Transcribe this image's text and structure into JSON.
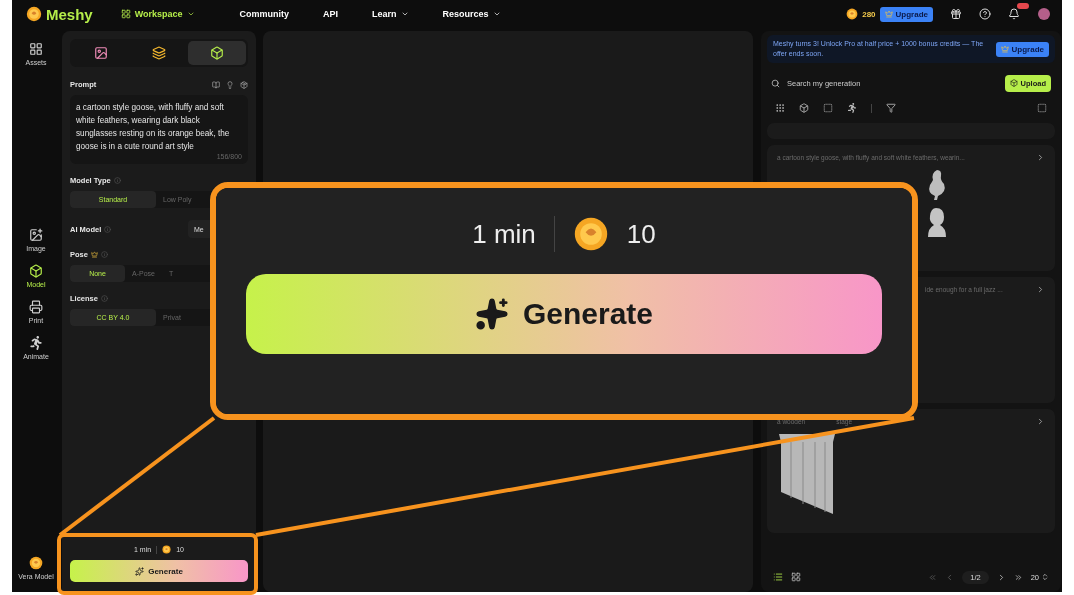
{
  "topbar": {
    "logo": "Meshy",
    "nav": [
      {
        "label": "Workspace",
        "kind": "workspace",
        "dropdown": true
      },
      {
        "label": "Community",
        "kind": "link",
        "dropdown": false
      },
      {
        "label": "API",
        "kind": "link",
        "dropdown": false
      },
      {
        "label": "Learn",
        "kind": "link",
        "dropdown": true
      },
      {
        "label": "Resources",
        "kind": "link",
        "dropdown": true
      }
    ],
    "credits": "280",
    "upgrade": "Upgrade"
  },
  "rail": [
    {
      "label": "Assets",
      "kind": "assets",
      "selected": false
    },
    {
      "label": "Image",
      "kind": "image",
      "selected": false
    },
    {
      "label": "Model",
      "kind": "model",
      "selected": true
    },
    {
      "label": "Print",
      "kind": "print",
      "selected": false
    },
    {
      "label": "Animate",
      "kind": "animate",
      "selected": false
    },
    {
      "label": "Vera Model",
      "kind": "vera",
      "selected": false
    }
  ],
  "generator": {
    "tabs": [
      {
        "kind": "image",
        "selected": false
      },
      {
        "kind": "multi",
        "selected": false
      },
      {
        "kind": "text",
        "selected": true
      }
    ],
    "prompt_label": "Prompt",
    "prompt": "a cartoon style goose, with fluffy and soft white feathers, wearing dark black sunglasses resting on its orange beak, the goose is in a cute round art style",
    "counter": "156/800",
    "settings": [
      {
        "label": "Model Type",
        "kind": "segmented",
        "premium": false,
        "options": [
          {
            "label": "Standard",
            "selected": true
          },
          {
            "label": "Low Poly",
            "selected": false
          }
        ]
      },
      {
        "label": "AI Model",
        "kind": "dropdown",
        "premium": false,
        "value": "Me"
      },
      {
        "label": "Pose",
        "kind": "segmented",
        "premium": true,
        "options": [
          {
            "label": "None",
            "selected": true
          },
          {
            "label": "A-Pose",
            "selected": false
          },
          {
            "label": "T",
            "selected": false
          }
        ]
      },
      {
        "label": "License",
        "kind": "segmented",
        "premium": false,
        "options": [
          {
            "label": "CC BY 4.0",
            "selected": true
          },
          {
            "label": "Privat",
            "selected": false
          }
        ]
      }
    ],
    "time": "1 min",
    "cost": "10",
    "generate": "Generate"
  },
  "callout": {
    "time": "1 min",
    "cost": "10",
    "generate": "Generate"
  },
  "library": {
    "banner": "Meshy turns 3! Unlock Pro at half price + 1000 bonus credits — The offer ends soon.",
    "banner_button": "Upgrade",
    "search": {
      "placeholder": "Search my generation"
    },
    "upload": "Upload",
    "filters": [
      {
        "kind": "all"
      },
      {
        "kind": "model"
      },
      {
        "kind": "texture"
      },
      {
        "kind": "animation"
      },
      {
        "kind": "funnel"
      }
    ],
    "cards": [
      {
        "title_parts": [
          "a cartoon style goose, with fluffy and soft white feathers, wearin..."
        ],
        "covered": false,
        "thumbnails": [
          {
            "kind": "goose"
          },
          {
            "kind": "bust"
          }
        ]
      },
      {
        "title_parts": [
          "ide enough for a full jazz ..."
        ],
        "covered": true
      },
      {
        "title_parts": [
          "a wooden",
          "stage"
        ],
        "covered": false,
        "thumbnails": [
          {
            "kind": "curtain"
          }
        ]
      }
    ],
    "views": [
      {
        "kind": "list",
        "selected": true
      },
      {
        "kind": "grid",
        "selected": false
      }
    ],
    "page": "1/2",
    "page_size": "20"
  }
}
